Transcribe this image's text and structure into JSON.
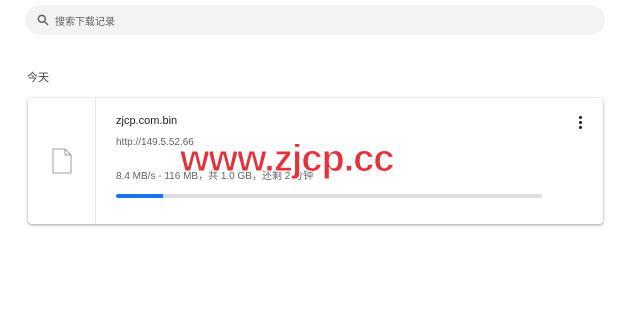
{
  "search": {
    "placeholder": "搜索下载记录"
  },
  "section": {
    "label": "今天"
  },
  "download": {
    "file_name": "zjcp.com.bin",
    "url": "http://149.5.52.66",
    "progress_text": "8.4 MB/s - 116 MB，共 1.0 GB，还剩 2 分钟",
    "progress_fraction": 0.11,
    "progress_color": "#1a73e8",
    "more_icon": "more-vert-icon",
    "file_icon": "file-icon"
  },
  "watermark": {
    "text": "www.zjcp.cc"
  }
}
